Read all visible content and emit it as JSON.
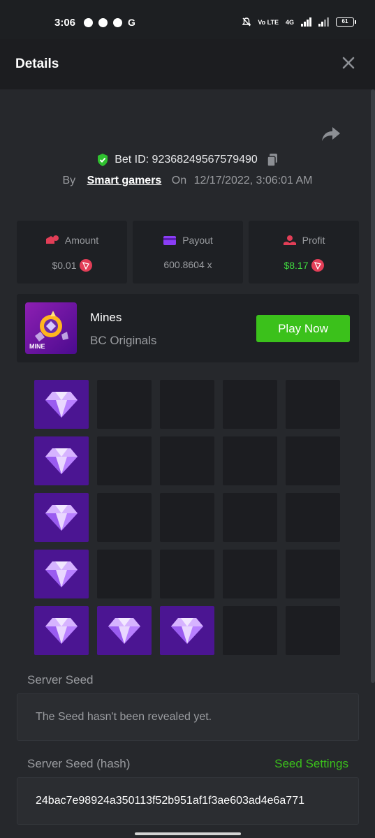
{
  "status_bar": {
    "time": "3:06",
    "right_label_1": "Vo LTE",
    "right_label_2": "4G",
    "battery": "61"
  },
  "header": {
    "title": "Details"
  },
  "bet": {
    "id_label": "Bet ID: 92368249567579490",
    "by_label": "By",
    "user": "Smart gamers",
    "on_label": "On",
    "date": "12/17/2022, 3:06:01 AM"
  },
  "stats": {
    "amount": {
      "label": "Amount",
      "value": "$0.01"
    },
    "payout": {
      "label": "Payout",
      "value": "600.8604 x"
    },
    "profit": {
      "label": "Profit",
      "value": "$8.17"
    }
  },
  "game": {
    "thumb_text": "MINE",
    "name": "Mines",
    "provider": "BC Originals",
    "play_label": "Play Now"
  },
  "mines_grid": {
    "rows": 5,
    "cols": 5,
    "gems": [
      [
        0,
        0
      ],
      [
        1,
        0
      ],
      [
        2,
        0
      ],
      [
        3,
        0
      ],
      [
        4,
        0
      ],
      [
        4,
        1
      ],
      [
        4,
        2
      ]
    ]
  },
  "seeds": {
    "server_seed_label": "Server Seed",
    "server_seed_value": "The Seed hasn't been revealed yet.",
    "server_hash_label": "Server Seed (hash)",
    "seed_settings_label": "Seed Settings",
    "server_hash_value": "24bac7e98924a350113f52b951af1f3ae603ad4e6a771"
  },
  "colors": {
    "accent_green": "#3bc11b",
    "gem_tile": "#4b1592",
    "coin_red": "#e23e57"
  }
}
